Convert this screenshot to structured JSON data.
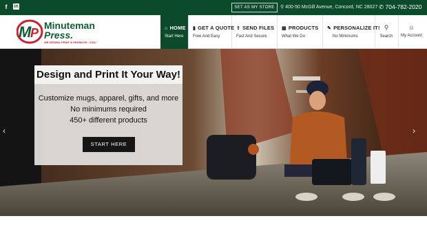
{
  "topbar": {
    "facebook_icon": "f",
    "linkedin_icon": "in",
    "set_store_label": "SET AS MY STORE",
    "address": "400-50 McGill Avenue, Concord, NC 28027",
    "phone": "704-782-2020"
  },
  "logo": {
    "brand_line1": "Minuteman",
    "brand_line2": "Press.",
    "tagline": "WE DESIGN, PRINT & PROMOTE...YOU!"
  },
  "nav": {
    "items": [
      {
        "title": "HOME",
        "sub": "Start Here",
        "icon": "home-icon"
      },
      {
        "title": "GET A QUOTE",
        "sub": "Free And Easy",
        "icon": "quote-icon"
      },
      {
        "title": "SEND FILES",
        "sub": "Fast And Secure",
        "icon": "upload-icon"
      },
      {
        "title": "PRODUCTS",
        "sub": "What We Do",
        "icon": "products-icon"
      },
      {
        "title": "PERSONALIZE IT!",
        "sub": "No Minimums",
        "icon": "personalize-icon"
      }
    ],
    "search_label": "Search",
    "account_label": "My Account"
  },
  "hero": {
    "headline": "Design and Print It Your Way!",
    "lines": [
      "Customize mugs, apparel, gifts, and more",
      "No minimums required",
      "450+ different products"
    ],
    "cta_label": "START HERE",
    "arrow_left": "‹",
    "arrow_right": "›"
  },
  "colors": {
    "brand_green": "#0b4a2b",
    "logo_red": "#c8202d",
    "logo_green": "#0d5e34"
  }
}
